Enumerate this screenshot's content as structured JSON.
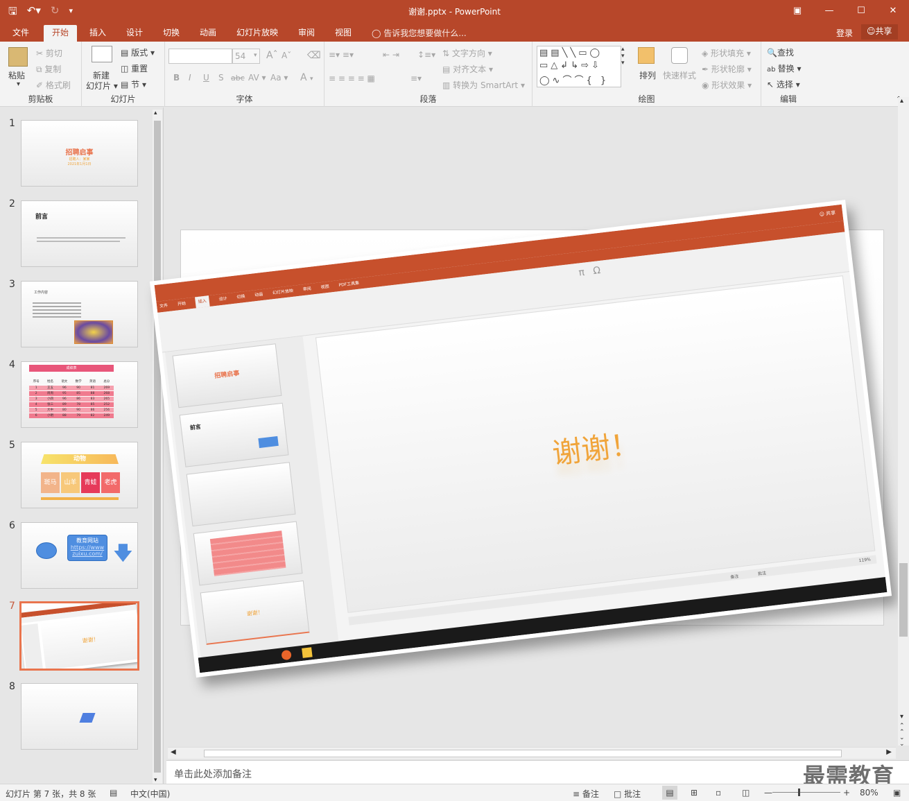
{
  "titlebar": {
    "document_title": "谢谢.pptx - PowerPoint",
    "qat": [
      "save-icon",
      "undo-icon",
      "redo-icon",
      "customize-icon"
    ],
    "window_controls": [
      "restore-ribbon-icon",
      "minimize-icon",
      "maximize-icon",
      "close-icon"
    ]
  },
  "tabs": {
    "items": [
      "文件",
      "开始",
      "插入",
      "设计",
      "切换",
      "动画",
      "幻灯片放映",
      "审阅",
      "视图"
    ],
    "active": "开始",
    "tell_me": "告诉我您想要做什么...",
    "login": "登录",
    "share": "共享"
  },
  "ribbon": {
    "clipboard": {
      "paste": "粘贴",
      "cut": "剪切",
      "copy": "复制",
      "format_painter": "格式刷",
      "label": "剪贴板"
    },
    "slides": {
      "new_slide_line1": "新建",
      "new_slide_line2": "幻灯片",
      "layout": "版式",
      "reset": "重置",
      "section": "节",
      "label": "幻灯片"
    },
    "font": {
      "font_name": "",
      "font_size": "54",
      "bold": "B",
      "italic": "I",
      "underline": "U",
      "shadow": "S",
      "strike": "abc",
      "spacing": "AV",
      "case": "Aa",
      "color": "A",
      "grow": "A",
      "shrink": "A",
      "label": "字体"
    },
    "paragraph": {
      "text_direction": "文字方向",
      "align_text": "对齐文本",
      "smartart": "转换为 SmartArt",
      "label": "段落"
    },
    "drawing": {
      "arrange": "排列",
      "quick_styles": "快速样式",
      "shape_fill": "形状填充",
      "shape_outline": "形状轮廓",
      "shape_effects": "形状效果",
      "label": "绘图"
    },
    "editing": {
      "find": "查找",
      "replace": "替换",
      "select": "选择",
      "label": "编辑"
    }
  },
  "thumbnails": {
    "numbers": [
      "1",
      "2",
      "3",
      "4",
      "5",
      "6",
      "7",
      "8"
    ],
    "selected": "7",
    "slide1": {
      "title": "招聘启事",
      "sub1": "招聘人：某某",
      "sub2": "2021年1月1日"
    },
    "slide2": {
      "title": "前言"
    },
    "slide3": {
      "title": "工作内容"
    },
    "slide4": {
      "table_title": "成绩表",
      "headers": [
        "序号",
        "姓名",
        "语文",
        "数学",
        "英语",
        "总分"
      ],
      "rows": [
        [
          "1",
          "王五",
          "96",
          "90",
          "81",
          "269"
        ],
        [
          "2",
          "周周",
          "95",
          "85",
          "88",
          "268"
        ],
        [
          "3",
          "小四",
          "96",
          "86",
          "83",
          "265"
        ],
        [
          "4",
          "张三",
          "89",
          "78",
          "85",
          "252"
        ],
        [
          "5",
          "大中",
          "80",
          "90",
          "86",
          "256"
        ],
        [
          "6",
          "小明",
          "88",
          "79",
          "82",
          "249"
        ]
      ]
    },
    "slide5": {
      "banner": "动物",
      "tiles": [
        "斑马",
        "山羊",
        "青蛙",
        "老虎"
      ]
    },
    "slide6": {
      "box_title": "教育网站",
      "link1": "https://www",
      "link2": "zuixu.com/"
    },
    "slide7": {
      "text": "谢谢！"
    }
  },
  "main_slide": {
    "text": "谢谢！",
    "embedded_tabs": [
      "文件",
      "开始",
      "插入",
      "设计",
      "切换",
      "动画",
      "幻灯片放映",
      "审阅",
      "视图",
      "PDF工具集"
    ],
    "embedded_thumb1": "招聘启事",
    "embedded_thumb2": "前言",
    "embedded_thumb5": "谢谢！",
    "embedded_zoom": "119%",
    "embedded_notes": "备注",
    "embedded_comments": "批注"
  },
  "notes": {
    "placeholder": "单击此处添加备注"
  },
  "watermark": "最需教育",
  "statusbar": {
    "slide_info": "幻灯片 第 7 张，共 8 张",
    "language": "中文(中国)",
    "notes": "备注",
    "comments": "批注",
    "zoom": "80%"
  },
  "colors": {
    "accent": "#b7472a",
    "thumb_selected": "#e9744d",
    "orange_text": "#f0a43a"
  }
}
